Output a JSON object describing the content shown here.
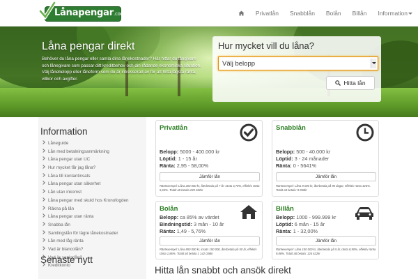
{
  "brand": {
    "logo_text": "Lånapengar",
    "logo_suffix": ".com",
    "color": "#2f7d32"
  },
  "nav": {
    "items": [
      {
        "label": "Privatlån"
      },
      {
        "label": "Snabblån"
      },
      {
        "label": "Bolån"
      },
      {
        "label": "Billån"
      },
      {
        "label": "Information"
      }
    ]
  },
  "hero": {
    "title": "Låna pengar direkt",
    "text": "Behöver du låna pengar eller samla dina lånekostnader? Här hittar du långivare och lånegivare som passar ditt kreditbehov och din rådande ekonomiska situation. Välj lånebelopp eller låneform som du är intresserad av för att hitta lägsta ränta, villkor och avgifter."
  },
  "calculator": {
    "title": "Hur mycket vill du låna?",
    "select_value": "Välj belopp",
    "button": "Hitta lån"
  },
  "sidebar": {
    "title": "Information",
    "items": [
      "Låneguide",
      "Lån med betalningsanmärkning",
      "Låna pengar utan UC",
      "Hur mycket får jag låna?",
      "Låna till kontantinsats",
      "Låna pengar utan säkerhet",
      "Lån utan inkomst",
      "Låna pengar med skuld hos Kronofogden",
      "Räkna på lån",
      "Låna pengar utan ränta",
      "Snabba lån",
      "Samlingslån för lägre lånekostnader",
      "Lån med låg ränta",
      "Vad är blancolån?",
      "Vad är seniorlån?",
      "Kreditkonto"
    ],
    "title2": "Senaste nytt"
  },
  "cards": [
    {
      "title": "Privatlån",
      "icon": "check-circle-icon",
      "rows": [
        {
          "label": "Belopp:",
          "value": "5000 - 400.000 kr"
        },
        {
          "label": "Löptid:",
          "value": "1 - 15 år"
        },
        {
          "label": "Ränta:",
          "value": "2,95 - 58,00%"
        }
      ],
      "button": "Jämför lån",
      "note": "Räntexempel: Låna 200 000 kr, återbetala på 7 år: ränta 3,70%, effektiv ränta 5,63%. Totalt att betala 239 282kr"
    },
    {
      "title": "Snabblån",
      "icon": "clock-icon",
      "rows": [
        {
          "label": "Belopp:",
          "value": "500 - 40.000 kr"
        },
        {
          "label": "Löptid:",
          "value": "3 - 24 månader"
        },
        {
          "label": "Ränta:",
          "value": "0 - 5641%"
        }
      ],
      "button": "Jämför lån",
      "note": "Räntexempel: Låna 8 000 kr, återbetala på 90 dagar, effektiv ränta 426%. Totalt att betala: 9.950kr"
    },
    {
      "title": "Bolån",
      "icon": "house-icon",
      "rows": [
        {
          "label": "Belopp:",
          "value": "ca 85% av värdet"
        },
        {
          "label": "Bindningstid:",
          "value": "3 mån - 10 år"
        },
        {
          "label": "Ränta:",
          "value": "1,49 - 5,76%"
        }
      ],
      "button": "Jämför lån",
      "note": "Räntexempel: Låna 850 000 kr, insats 150 000, återbetala på 50 år, effektiv ränta 1,86%. Totalt att betala 1 142 036kr"
    },
    {
      "title": "Billån",
      "icon": "car-icon",
      "rows": [
        {
          "label": "Belopp:",
          "value": "1000 - 999.999 kr"
        },
        {
          "label": "Löptid:",
          "value": "6 mån - 15 år"
        },
        {
          "label": "Ränta:",
          "value": "1 - 32,00%"
        }
      ],
      "button": "Jämför lån",
      "note": "Räntexempel: Låna 100 000 kr, återbetala på 5 år, ränta 8,90%, effektiv ränta 9,88%. Totalt att betala: 126 622kr"
    }
  ],
  "main": {
    "bottom_title": "Hitta lån snabbt och ansök direkt"
  }
}
